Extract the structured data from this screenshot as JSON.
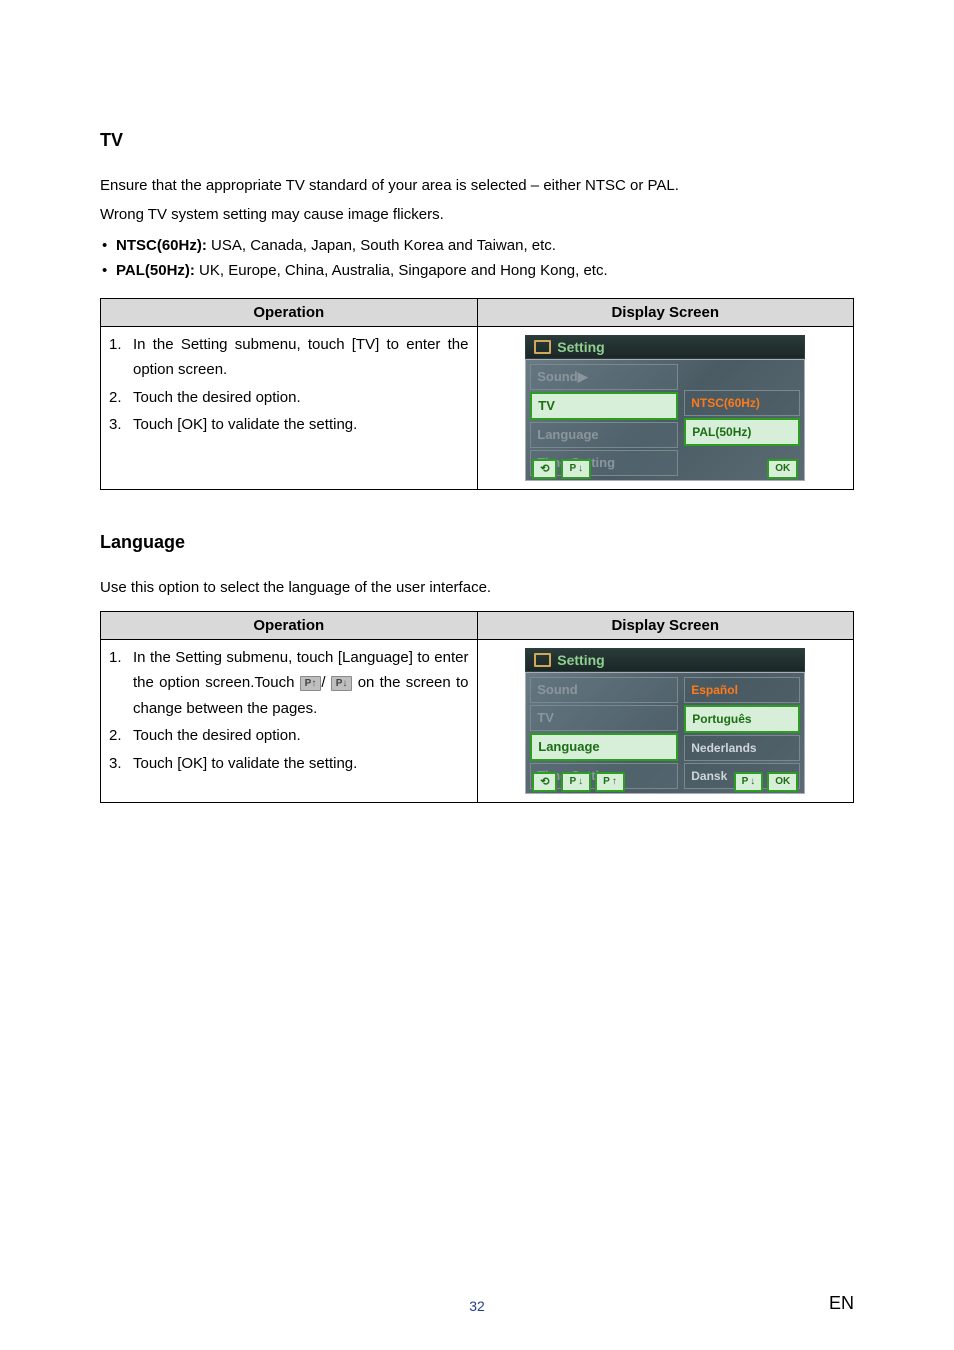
{
  "section_tv": {
    "heading": "TV",
    "intro1": "Ensure that the appropriate TV standard of your area is selected – either NTSC or PAL.",
    "intro2": "Wrong TV system setting may cause image flickers.",
    "bullet1_label": "NTSC(60Hz):",
    "bullet1_text": " USA, Canada, Japan, South Korea and Taiwan, etc.",
    "bullet2_label": "PAL(50Hz):",
    "bullet2_text": " UK, Europe, China, Australia, Singapore and Hong Kong, etc.",
    "col_operation": "Operation",
    "col_display": "Display Screen",
    "step1": "In the Setting submenu, touch [TV] to enter the option screen.",
    "step2": "Touch the desired option.",
    "step3": "Touch [OK] to validate the setting.",
    "screen": {
      "title": "Setting",
      "menu": [
        "Sound",
        "TV",
        "Language",
        "Time Setting"
      ],
      "opt_ntsc": "NTSC(60Hz)",
      "opt_pal": "PAL(50Hz)",
      "btn_p": "P",
      "btn_ok": "OK"
    }
  },
  "section_lang": {
    "heading": "Language",
    "intro": "Use this option to select the language of the user interface.",
    "col_operation": "Operation",
    "col_display": "Display Screen",
    "step1a": "In the Setting submenu, touch [Language] to enter the option screen.Touch ",
    "step1_btn1": "P↑",
    "step1_mid": "/  ",
    "step1_btn2": "P↓",
    "step1b": "on the screen to change between the pages.",
    "step2": "Touch the desired option.",
    "step3": "Touch [OK] to validate the setting.",
    "screen": {
      "title": "Setting",
      "menu": [
        "Sound",
        "TV",
        "Language",
        "Time Setting"
      ],
      "opts": [
        "Español",
        "Português",
        "Nederlands",
        "Dansk"
      ],
      "btn_p": "P",
      "btn_ok": "OK"
    }
  },
  "footer": {
    "page": "32",
    "lang": "EN"
  }
}
